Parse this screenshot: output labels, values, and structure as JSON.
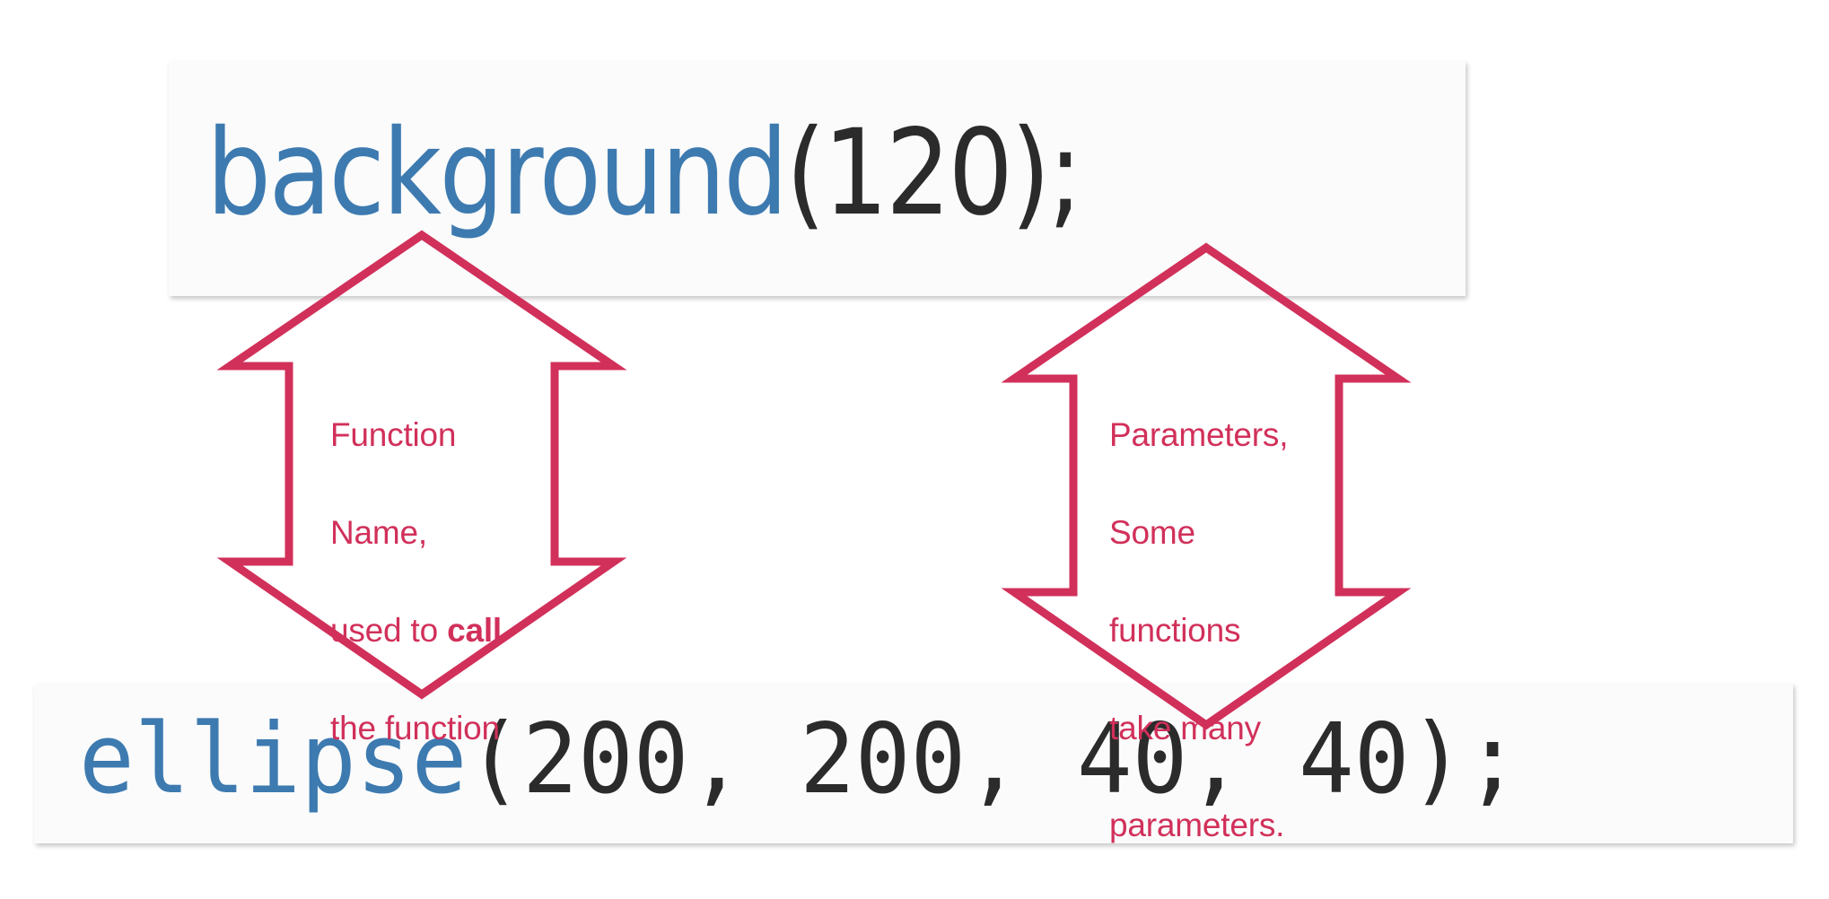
{
  "colors": {
    "accent": "#d1305a",
    "function_blue": "#3d7ab0",
    "punctuation": "#2b2b2b",
    "code_background": "#fbfbfb",
    "page_background": "#ffffff"
  },
  "code_top": {
    "function_name": "background",
    "arguments": "(120);",
    "full_text": "background(120);"
  },
  "code_bottom": {
    "function_name": "ellipse",
    "arguments": "(200, 200, 40, 40);",
    "full_text": "ellipse(200, 200, 40, 40);"
  },
  "annotations": {
    "left": {
      "line1": "Function",
      "line2": "Name,",
      "line3_prefix": "used to ",
      "line3_bold": "call",
      "line4": "the function"
    },
    "right": {
      "line1": "Parameters,",
      "line2": "Some",
      "line3": "functions",
      "line4": "take many",
      "line5": "parameters."
    }
  },
  "arrows": {
    "left_label": "double-headed-arrow-function-name",
    "right_label": "double-headed-arrow-parameters"
  }
}
